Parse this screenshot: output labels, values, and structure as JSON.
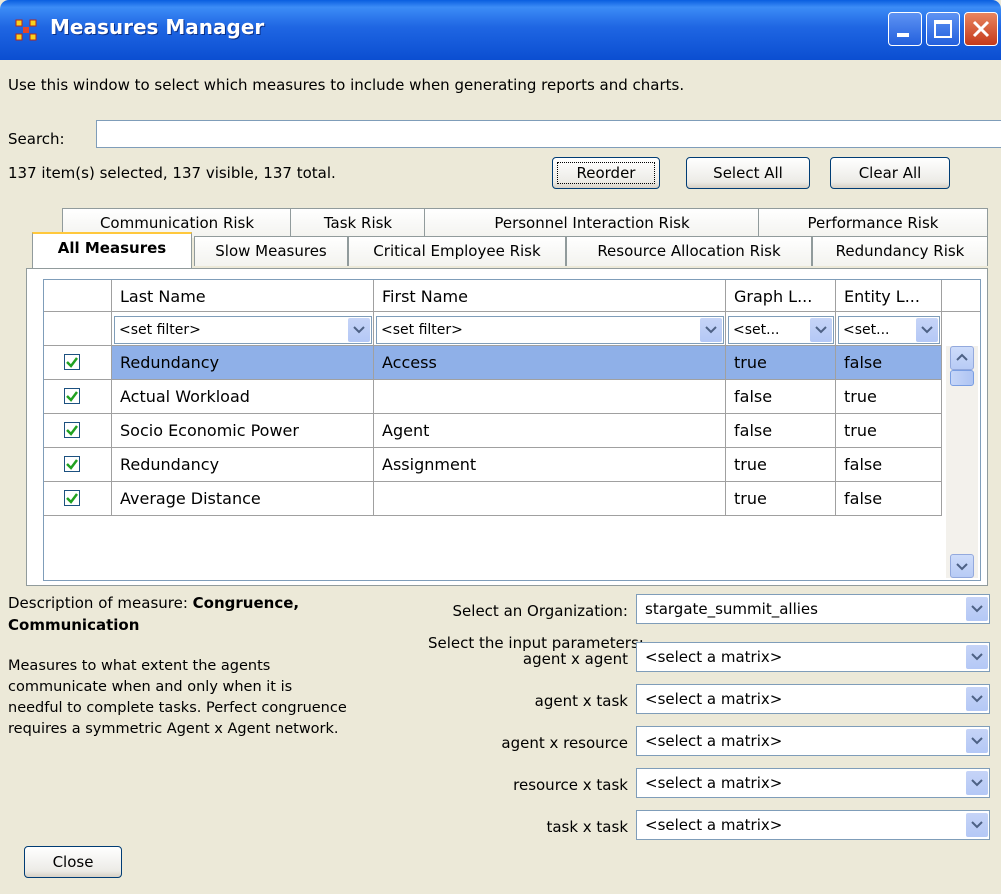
{
  "window": {
    "title": "Measures Manager",
    "app_icon": "network-nodes-icon"
  },
  "intro_text": "Use this window to select which measures to include when generating reports and charts.",
  "search": {
    "label": "Search:",
    "value": ""
  },
  "status_text": "137 item(s) selected, 137 visible, 137 total.",
  "buttons": {
    "reorder": "Reorder",
    "select_all": "Select All",
    "clear_all": "Clear All",
    "close": "Close"
  },
  "tabs_back_row": [
    "Communication Risk",
    "Task Risk",
    "Personnel Interaction Risk",
    "Performance Risk"
  ],
  "tabs_front_row": [
    "All Measures",
    "Slow Measures",
    "Critical Employee Risk",
    "Resource Allocation Risk",
    "Redundancy Risk"
  ],
  "active_tab": "All Measures",
  "table": {
    "columns": [
      "Last Name",
      "First Name",
      "Graph L...",
      "Entity L..."
    ],
    "filters": [
      "<set filter>",
      "<set filter>",
      "<set...",
      "<set..."
    ],
    "rows": [
      {
        "checked": true,
        "last": "Redundancy",
        "first": "Access",
        "graph": "true",
        "entity": "false",
        "selected": true
      },
      {
        "checked": true,
        "last": "Actual Workload",
        "first": "",
        "graph": "false",
        "entity": "true",
        "selected": false
      },
      {
        "checked": true,
        "last": "Socio Economic Power",
        "first": "Agent",
        "graph": "false",
        "entity": "true",
        "selected": false
      },
      {
        "checked": true,
        "last": "Redundancy",
        "first": "Assignment",
        "graph": "true",
        "entity": "false",
        "selected": false
      },
      {
        "checked": true,
        "last": "Average Distance",
        "first": "",
        "graph": "true",
        "entity": "false",
        "selected": false
      }
    ]
  },
  "description": {
    "label_prefix": "Description of measure: ",
    "measure_name": "Congruence, Communication",
    "text": "Measures to what extent the agents communicate when and only when it is needful to complete tasks. Perfect congruence requires a symmetric Agent x Agent network."
  },
  "organization": {
    "label": "Select an Organization:",
    "value": "stargate_summit_allies"
  },
  "input_params_label": "Select the input parameters:",
  "params": [
    {
      "label": "agent x agent",
      "value": "<select a matrix>"
    },
    {
      "label": "agent x task",
      "value": "<select a matrix>"
    },
    {
      "label": "agent x resource",
      "value": "<select a matrix>"
    },
    {
      "label": "resource x task",
      "value": "<select a matrix>"
    },
    {
      "label": "task x task",
      "value": "<select a matrix>"
    }
  ]
}
